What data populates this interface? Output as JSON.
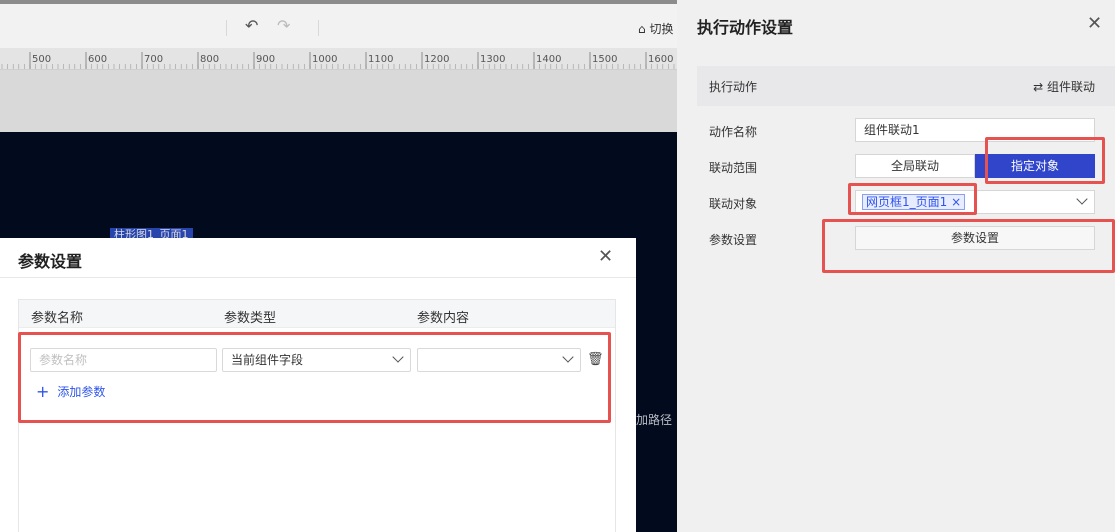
{
  "toolbar": {
    "undo_icon": "undo-icon",
    "redo_icon": "redo-icon",
    "switch_icon": "shirt-icon",
    "switch_label": "切换"
  },
  "ruler": {
    "ticks": [
      "500",
      "600",
      "700",
      "800",
      "900",
      "1000",
      "1100",
      "1200",
      "1300",
      "1400",
      "1500",
      "1600"
    ]
  },
  "canvas": {
    "component_tag": "柱形图1_页面1",
    "path_text": "加路径"
  },
  "param_dialog": {
    "title": "参数设置",
    "close_icon": "close-icon",
    "columns": [
      "参数名称",
      "参数类型",
      "参数内容"
    ],
    "row": {
      "name_placeholder": "参数名称",
      "type_value": "当前组件字段",
      "content_value": ""
    },
    "add_label": "添加参数"
  },
  "panel": {
    "title": "执行动作设置",
    "close_icon": "close-icon",
    "action_label": "执行动作",
    "action_type": "⇄ 组件联动",
    "fields": {
      "name_label": "动作名称",
      "name_value": "组件联动1",
      "scope_label": "联动范围",
      "scope_options": [
        "全局联动",
        "指定对象"
      ],
      "scope_selected": "指定对象",
      "target_label": "联动对象",
      "target_tag": "网页框1_页面1 ×",
      "param_label": "参数设置",
      "param_button": "参数设置"
    }
  },
  "colors": {
    "accent": "#3045c9",
    "highlight": "#e5524f",
    "canvas_dark": "#020b1d"
  }
}
